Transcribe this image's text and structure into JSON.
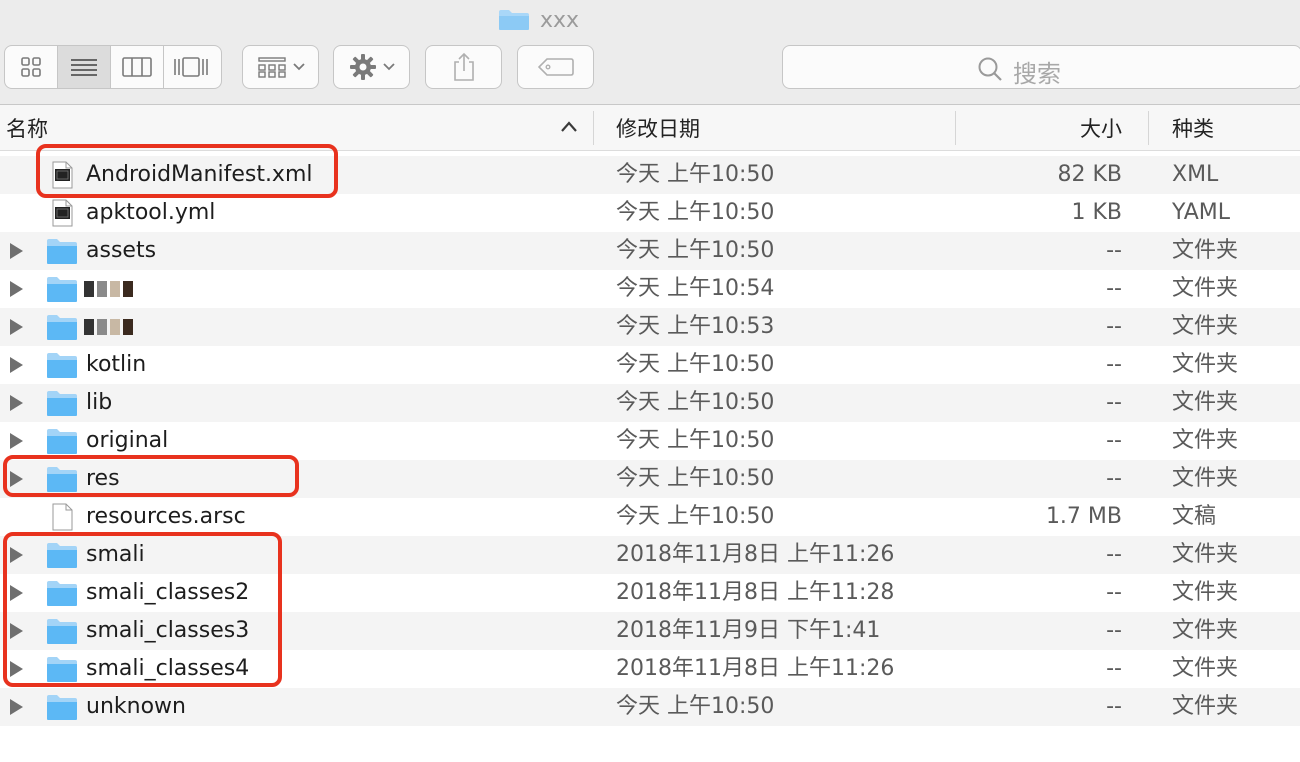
{
  "window": {
    "title": "xxx"
  },
  "search": {
    "placeholder": "搜索",
    "icon": "search-icon"
  },
  "columns": {
    "name": "名称",
    "date": "修改日期",
    "size": "大小",
    "kind": "种类"
  },
  "colors": {
    "folder": "#5cb8f5",
    "highlight": "#e8321e"
  },
  "rows": [
    {
      "name": "AndroidManifest.xml",
      "date": "今天 上午10:50",
      "size": "82 KB",
      "kind": "XML",
      "icon": "xml-file-icon",
      "highlighted": true
    },
    {
      "name": "apktool.yml",
      "date": "今天 上午10:50",
      "size": "1 KB",
      "kind": "YAML",
      "icon": "yaml-file-icon"
    },
    {
      "name": "assets",
      "date": "今天 上午10:50",
      "size": "--",
      "kind": "文件夹",
      "icon": "folder-icon"
    },
    {
      "name": "",
      "date": "今天 上午10:54",
      "size": "--",
      "kind": "文件夹",
      "icon": "folder-icon",
      "redacted": true
    },
    {
      "name": "",
      "date": "今天 上午10:53",
      "size": "--",
      "kind": "文件夹",
      "icon": "folder-icon",
      "redacted": true
    },
    {
      "name": "kotlin",
      "date": "今天 上午10:50",
      "size": "--",
      "kind": "文件夹",
      "icon": "folder-icon"
    },
    {
      "name": "lib",
      "date": "今天 上午10:50",
      "size": "--",
      "kind": "文件夹",
      "icon": "folder-icon"
    },
    {
      "name": "original",
      "date": "今天 上午10:50",
      "size": "--",
      "kind": "文件夹",
      "icon": "folder-icon"
    },
    {
      "name": "res",
      "date": "今天 上午10:50",
      "size": "--",
      "kind": "文件夹",
      "icon": "folder-icon",
      "highlighted": true
    },
    {
      "name": "resources.arsc",
      "date": "今天 上午10:50",
      "size": "1.7 MB",
      "kind": "文稿",
      "icon": "document-icon"
    },
    {
      "name": "smali",
      "date": "2018年11月8日 上午11:26",
      "size": "--",
      "kind": "文件夹",
      "icon": "folder-icon",
      "highlighted": true
    },
    {
      "name": "smali_classes2",
      "date": "2018年11月8日 上午11:28",
      "size": "--",
      "kind": "文件夹",
      "icon": "folder-icon",
      "highlighted": true
    },
    {
      "name": "smali_classes3",
      "date": "2018年11月9日 下午1:41",
      "size": "--",
      "kind": "文件夹",
      "icon": "folder-icon",
      "highlighted": true
    },
    {
      "name": "smali_classes4",
      "date": "2018年11月8日 上午11:26",
      "size": "--",
      "kind": "文件夹",
      "icon": "folder-icon",
      "highlighted": true
    },
    {
      "name": "unknown",
      "date": "今天 上午10:50",
      "size": "--",
      "kind": "文件夹",
      "icon": "folder-icon"
    }
  ]
}
